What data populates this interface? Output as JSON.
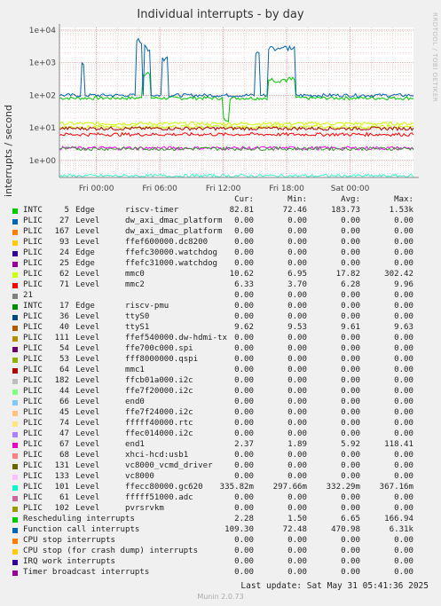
{
  "title": "Individual interrupts - by day",
  "watermark": "RRDTOOL / TOBI OETIKER",
  "chart_data": {
    "type": "line",
    "title": "Individual interrupts - by day",
    "ylabel": "interrupts / second",
    "yscale": "log",
    "yticks": [
      "1e+00",
      "1e+01",
      "1e+02",
      "1e+03",
      "1e+04"
    ],
    "ytick_values": [
      1,
      10,
      100,
      1000,
      10000
    ],
    "xticks": [
      "Fri 00:00",
      "Fri 06:00",
      "Fri 12:00",
      "Fri 18:00",
      "Sat 00:00"
    ],
    "xrange_hours": [
      -3.5,
      30
    ],
    "grid": true,
    "series": [
      {
        "name": "riscv-timer",
        "color": "#00cc00",
        "base": 82,
        "bursts": [
          [
            4.3,
            5.1,
            500
          ],
          [
            12.0,
            12.5,
            20
          ],
          [
            16.2,
            18.8,
            320
          ]
        ]
      },
      {
        "name": "Function call interrupts",
        "color": "#0066b3",
        "base": 100,
        "bursts": [
          [
            -1.5,
            -1.2,
            1000
          ],
          [
            3.8,
            4.3,
            5000
          ],
          [
            4.5,
            5.1,
            3000
          ],
          [
            6.2,
            6.8,
            1500
          ],
          [
            15.0,
            15.5,
            2000
          ],
          [
            16.2,
            18.8,
            3000
          ]
        ]
      },
      {
        "name": "ffe7f20000.i2c",
        "color": "#ccff00",
        "base": 13.5
      },
      {
        "name": "mmc0",
        "color": "#ccff00",
        "base": 10.6
      },
      {
        "name": "ttyS1",
        "color": "#aa0000",
        "base": 9.6
      },
      {
        "name": "mmc2",
        "color": "#ff0000",
        "base": 6.3
      },
      {
        "name": "end1",
        "color": "#ff00ff",
        "base": 2.4
      },
      {
        "name": "Rescheduling interrupts",
        "color": "#339933",
        "base": 2.3
      },
      {
        "name": "ffecc80000.gc620",
        "color": "#33ffcc",
        "base": 0.336
      }
    ]
  },
  "legend": {
    "headers": [
      "Cur:",
      "Min:",
      "Avg:",
      "Max:"
    ],
    "rows": [
      {
        "color": "#00cc00",
        "src": "INTC",
        "num": "5",
        "type": "Edge",
        "name": "riscv-timer",
        "cur": "82.81",
        "min": "72.46",
        "avg": "183.73",
        "max": "1.53k"
      },
      {
        "color": "#0066b3",
        "src": "PLIC",
        "num": "27",
        "type": "Level",
        "name": "dw_axi_dmac_platform",
        "cur": "0.00",
        "min": "0.00",
        "avg": "0.00",
        "max": "0.00"
      },
      {
        "color": "#ff8000",
        "src": "PLIC",
        "num": "167",
        "type": "Level",
        "name": "dw_axi_dmac_platform",
        "cur": "0.00",
        "min": "0.00",
        "avg": "0.00",
        "max": "0.00"
      },
      {
        "color": "#ffcc00",
        "src": "PLIC",
        "num": "93",
        "type": "Level",
        "name": "ffef600000.dc8200",
        "cur": "0.00",
        "min": "0.00",
        "avg": "0.00",
        "max": "0.00"
      },
      {
        "color": "#330099",
        "src": "PLIC",
        "num": "24",
        "type": "Edge",
        "name": "ffefc30000.watchdog",
        "cur": "0.00",
        "min": "0.00",
        "avg": "0.00",
        "max": "0.00"
      },
      {
        "color": "#990099",
        "src": "PLIC",
        "num": "25",
        "type": "Edge",
        "name": "ffefc31000.watchdog",
        "cur": "0.00",
        "min": "0.00",
        "avg": "0.00",
        "max": "0.00"
      },
      {
        "color": "#ccff00",
        "src": "PLIC",
        "num": "62",
        "type": "Level",
        "name": "mmc0",
        "cur": "10.62",
        "min": "6.95",
        "avg": "17.82",
        "max": "302.42"
      },
      {
        "color": "#ff0000",
        "src": "PLIC",
        "num": "71",
        "type": "Level",
        "name": "mmc2",
        "cur": "6.33",
        "min": "3.70",
        "avg": "6.28",
        "max": "9.96"
      },
      {
        "color": "#808080",
        "src": "21",
        "num": "",
        "type": "",
        "name": "",
        "cur": "0.00",
        "min": "0.00",
        "avg": "0.00",
        "max": "0.00"
      },
      {
        "color": "#008f00",
        "src": "INTC",
        "num": "17",
        "type": "Edge",
        "name": "riscv-pmu",
        "cur": "0.00",
        "min": "0.00",
        "avg": "0.00",
        "max": "0.00"
      },
      {
        "color": "#00487d",
        "src": "PLIC",
        "num": "36",
        "type": "Level",
        "name": "ttyS0",
        "cur": "0.00",
        "min": "0.00",
        "avg": "0.00",
        "max": "0.00"
      },
      {
        "color": "#b35a00",
        "src": "PLIC",
        "num": "40",
        "type": "Level",
        "name": "ttyS1",
        "cur": "9.62",
        "min": "9.53",
        "avg": "9.61",
        "max": "9.63"
      },
      {
        "color": "#b38f00",
        "src": "PLIC",
        "num": "111",
        "type": "Level",
        "name": "ffef540000.dw-hdmi-tx",
        "cur": "0.00",
        "min": "0.00",
        "avg": "0.00",
        "max": "0.00"
      },
      {
        "color": "#6b006b",
        "src": "PLIC",
        "num": "54",
        "type": "Level",
        "name": "ffe700c000.spi",
        "cur": "0.00",
        "min": "0.00",
        "avg": "0.00",
        "max": "0.00"
      },
      {
        "color": "#8fb300",
        "src": "PLIC",
        "num": "53",
        "type": "Level",
        "name": "fff8000000.qspi",
        "cur": "0.00",
        "min": "0.00",
        "avg": "0.00",
        "max": "0.00"
      },
      {
        "color": "#b30000",
        "src": "PLIC",
        "num": "64",
        "type": "Level",
        "name": "mmc1",
        "cur": "0.00",
        "min": "0.00",
        "avg": "0.00",
        "max": "0.00"
      },
      {
        "color": "#bebebe",
        "src": "PLIC",
        "num": "182",
        "type": "Level",
        "name": "ffcb01a000.i2c",
        "cur": "0.00",
        "min": "0.00",
        "avg": "0.00",
        "max": "0.00"
      },
      {
        "color": "#80ff80",
        "src": "PLIC",
        "num": "44",
        "type": "Level",
        "name": "ffe7f20000.i2c",
        "cur": "0.00",
        "min": "0.00",
        "avg": "0.00",
        "max": "0.00"
      },
      {
        "color": "#80c9ff",
        "src": "PLIC",
        "num": "66",
        "type": "Level",
        "name": "end0",
        "cur": "0.00",
        "min": "0.00",
        "avg": "0.00",
        "max": "0.00"
      },
      {
        "color": "#ffc080",
        "src": "PLIC",
        "num": "45",
        "type": "Level",
        "name": "ffe7f24000.i2c",
        "cur": "0.00",
        "min": "0.00",
        "avg": "0.00",
        "max": "0.00"
      },
      {
        "color": "#ffe680",
        "src": "PLIC",
        "num": "74",
        "type": "Level",
        "name": "fffff40000.rtc",
        "cur": "0.00",
        "min": "0.00",
        "avg": "0.00",
        "max": "0.00"
      },
      {
        "color": "#aa80ff",
        "src": "PLIC",
        "num": "47",
        "type": "Level",
        "name": "ffec014000.i2c",
        "cur": "0.00",
        "min": "0.00",
        "avg": "0.00",
        "max": "0.00"
      },
      {
        "color": "#ee00cc",
        "src": "PLIC",
        "num": "67",
        "type": "Level",
        "name": "end1",
        "cur": "2.37",
        "min": "1.89",
        "avg": "5.92",
        "max": "118.41"
      },
      {
        "color": "#ff8080",
        "src": "PLIC",
        "num": "68",
        "type": "Level",
        "name": "xhci-hcd:usb1",
        "cur": "0.00",
        "min": "0.00",
        "avg": "0.00",
        "max": "0.00"
      },
      {
        "color": "#666600",
        "src": "PLIC",
        "num": "131",
        "type": "Level",
        "name": "vc8000_vcmd_driver",
        "cur": "0.00",
        "min": "0.00",
        "avg": "0.00",
        "max": "0.00"
      },
      {
        "color": "#ffbfff",
        "src": "PLIC",
        "num": "133",
        "type": "Level",
        "name": "vc8000",
        "cur": "0.00",
        "min": "0.00",
        "avg": "0.00",
        "max": "0.00"
      },
      {
        "color": "#00ffcc",
        "src": "PLIC",
        "num": "101",
        "type": "Level",
        "name": "ffecc80000.gc620",
        "cur": "335.82m",
        "min": "297.66m",
        "avg": "332.29m",
        "max": "367.16m"
      },
      {
        "color": "#cc6699",
        "src": "PLIC",
        "num": "61",
        "type": "Level",
        "name": "fffff51000.adc",
        "cur": "0.00",
        "min": "0.00",
        "avg": "0.00",
        "max": "0.00"
      },
      {
        "color": "#999900",
        "src": "PLIC",
        "num": "102",
        "type": "Level",
        "name": "pvrsrvkm",
        "cur": "0.00",
        "min": "0.00",
        "avg": "0.00",
        "max": "0.00"
      },
      {
        "color": "#00cc00",
        "src": "Rescheduling interrupts",
        "num": "",
        "type": "",
        "name": "",
        "cur": "2.28",
        "min": "1.50",
        "avg": "6.65",
        "max": "166.94"
      },
      {
        "color": "#0066b3",
        "src": "Function call interrupts",
        "num": "",
        "type": "",
        "name": "",
        "cur": "109.30",
        "min": "72.48",
        "avg": "470.98",
        "max": "6.31k"
      },
      {
        "color": "#ff8000",
        "src": "CPU stop interrupts",
        "num": "",
        "type": "",
        "name": "",
        "cur": "0.00",
        "min": "0.00",
        "avg": "0.00",
        "max": "0.00"
      },
      {
        "color": "#ffcc00",
        "src": "CPU stop (for crash dump) interrupts",
        "num": "",
        "type": "",
        "name": "",
        "cur": "0.00",
        "min": "0.00",
        "avg": "0.00",
        "max": "0.00"
      },
      {
        "color": "#330099",
        "src": "IRQ work interrupts",
        "num": "",
        "type": "",
        "name": "",
        "cur": "0.00",
        "min": "0.00",
        "avg": "0.00",
        "max": "0.00"
      },
      {
        "color": "#990099",
        "src": "Timer broadcast interrupts",
        "num": "",
        "type": "",
        "name": "",
        "cur": "0.00",
        "min": "0.00",
        "avg": "0.00",
        "max": "0.00"
      }
    ]
  },
  "last_update": "Last update: Sat May 31 05:41:36 2025",
  "munin_version": "Munin 2.0.73"
}
